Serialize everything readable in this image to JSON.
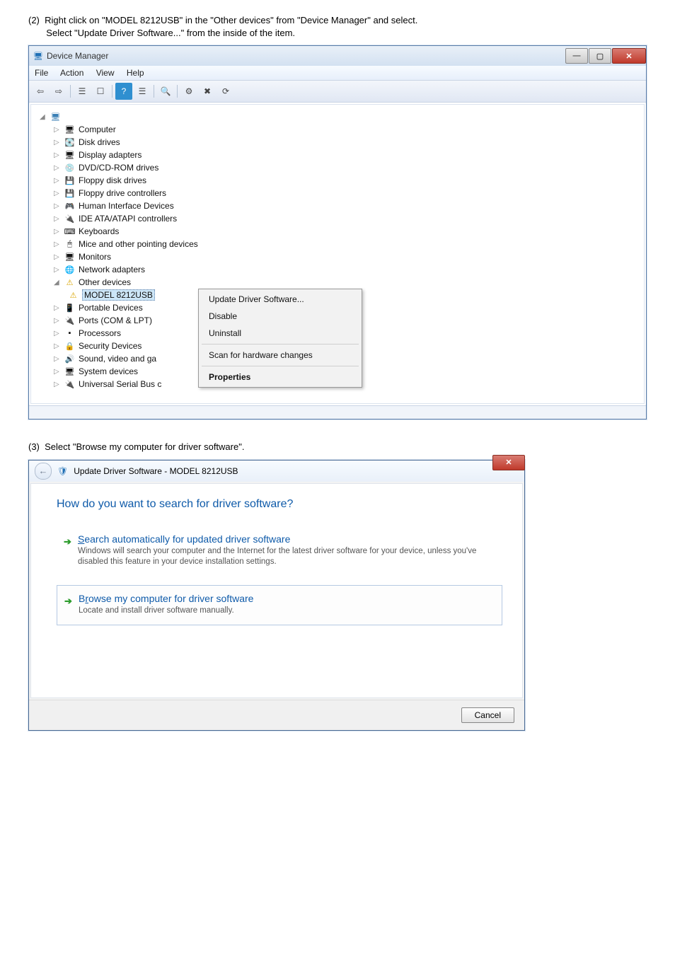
{
  "step2": {
    "label": "(2)",
    "text_a": "Right click on \"MODEL 8212USB\" in the \"Other devices\" from \"Device Manager\" and select.",
    "text_b": "Select \"Update Driver Software...\" from the inside of the item."
  },
  "devmgr": {
    "title": "Device Manager",
    "menus": {
      "file": "File",
      "action": "Action",
      "view": "View",
      "help": "Help"
    },
    "tree": {
      "root": "",
      "items": [
        "Computer",
        "Disk drives",
        "Display adapters",
        "DVD/CD-ROM drives",
        "Floppy disk drives",
        "Floppy drive controllers",
        "Human Interface Devices",
        "IDE ATA/ATAPI controllers",
        "Keyboards",
        "Mice and other pointing devices",
        "Monitors",
        "Network adapters",
        "Other devices",
        "MODEL 8212USB",
        "Portable Devices",
        "Ports (COM & LPT)",
        "Processors",
        "Security Devices",
        "Sound, video and ga",
        "System devices",
        "Universal Serial Bus c"
      ]
    },
    "context": {
      "update": "Update Driver Software...",
      "disable": "Disable",
      "uninstall": "Uninstall",
      "scan": "Scan for hardware changes",
      "properties": "Properties"
    }
  },
  "step3": {
    "label": "(3)",
    "text": "Select \"Browse my computer for driver software\"."
  },
  "dialog": {
    "title": "Update Driver Software - MODEL 8212USB",
    "heading": "How do you want to search for driver software?",
    "opt1": {
      "title": "Search automatically for updated driver software",
      "desc": "Windows will search your computer and the Internet for the latest driver software for your device, unless you've disabled this feature in your device installation settings."
    },
    "opt2": {
      "title": "Browse my computer for driver software",
      "desc": "Locate and install driver software manually."
    },
    "cancel": "Cancel"
  }
}
